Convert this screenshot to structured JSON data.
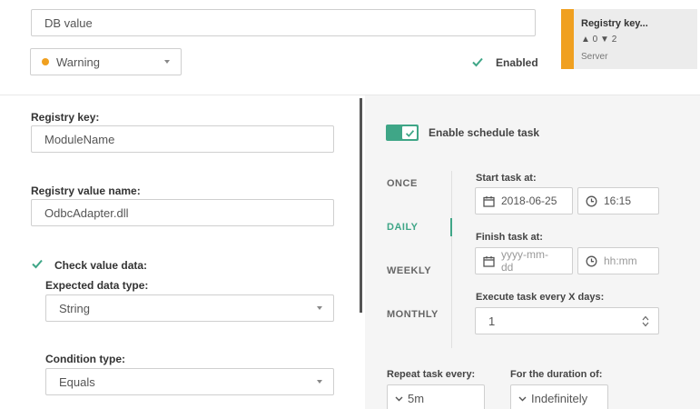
{
  "top": {
    "db_value": "DB value",
    "severity": "Warning",
    "enabled_label": "Enabled",
    "enabled_checked": true,
    "card": {
      "title": "Registry key...",
      "counts": "▲ 0 ▼ 2",
      "subtitle": "Server"
    }
  },
  "left": {
    "registry_key_label": "Registry key:",
    "registry_key_value": "ModuleName",
    "registry_value_name_label": "Registry value name:",
    "registry_value_name_value": "OdbcAdapter.dll",
    "check_value_label": "Check value data:",
    "check_value_checked": true,
    "expected_type_label": "Expected data type:",
    "expected_type_value": "String",
    "condition_type_label": "Condition type:",
    "condition_type_value": "Equals"
  },
  "schedule": {
    "enable_label": "Enable schedule task",
    "enabled": true,
    "tabs": [
      "ONCE",
      "DAILY",
      "WEEKLY",
      "MONTHLY"
    ],
    "active_tab": "DAILY",
    "start_label": "Start task at:",
    "start_date": "2018-06-25",
    "start_time": "16:15",
    "finish_label": "Finish task at:",
    "finish_date_placeholder": "yyyy-mm-dd",
    "finish_time_placeholder": "hh:mm",
    "every_label": "Execute task every X days:",
    "every_value": "1",
    "repeat_label": "Repeat task every:",
    "repeat_value": "5m",
    "duration_label": "For the duration of:",
    "duration_value": "Indefinitely"
  },
  "colors": {
    "accent": "#3fa687",
    "warning": "#f0a020"
  }
}
